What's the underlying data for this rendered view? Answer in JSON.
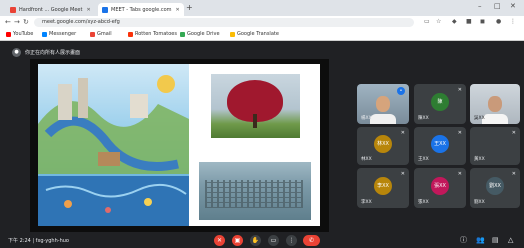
{
  "browser": {
    "tabs": [
      {
        "label": "Hardfront ... Google Meet",
        "active": false,
        "close": "✕"
      },
      {
        "label": "MEET - Tabs google.com",
        "active": true,
        "close": "✕"
      }
    ],
    "new_tab": "+",
    "url": "meet.google.com/xyz-abcd-efg",
    "bookmarks": [
      "YouTube",
      "Messenger",
      "Gmail",
      "Rotten Tomatoes",
      "Google Drive",
      "Google Translate"
    ]
  },
  "meeting": {
    "presenter_label": "你正在向所有人展示畫面"
  },
  "participants": [
    {
      "name": "楊XX",
      "initial": "楊",
      "color": "#ffffff",
      "type": "camera"
    },
    {
      "name": "陳XX",
      "initial": "陳",
      "color": "#2e7d32",
      "type": "avatar"
    },
    {
      "name": "吳XX",
      "initial": "吳",
      "color": "#ffffff",
      "type": "camera2"
    },
    {
      "name": "林XX",
      "initial": "林XX",
      "color": "#b8860b",
      "type": "avatar"
    },
    {
      "name": "王XX",
      "initial": "王XX",
      "color": "#1a73e8",
      "type": "avatar"
    },
    {
      "name": "黃XX",
      "initial": "",
      "color": "#3c4043",
      "type": "empty"
    },
    {
      "name": "李XX",
      "initial": "李XX",
      "color": "#b8860b",
      "type": "avatar"
    },
    {
      "name": "張XX",
      "initial": "張XX",
      "color": "#c2185b",
      "type": "avatar"
    },
    {
      "name": "劉XX",
      "initial": "劉XX",
      "color": "#455a64",
      "type": "avatar"
    }
  ],
  "bottom_bar": {
    "time_label": "下午 2:24 | fxg-yghh-huo",
    "controls": [
      "mic-off",
      "cam-off",
      "hand",
      "present",
      "more"
    ],
    "end": "✆"
  },
  "colors": {
    "accent_red": "#ea4335",
    "bg": "#202124",
    "tile": "#3c4043"
  }
}
